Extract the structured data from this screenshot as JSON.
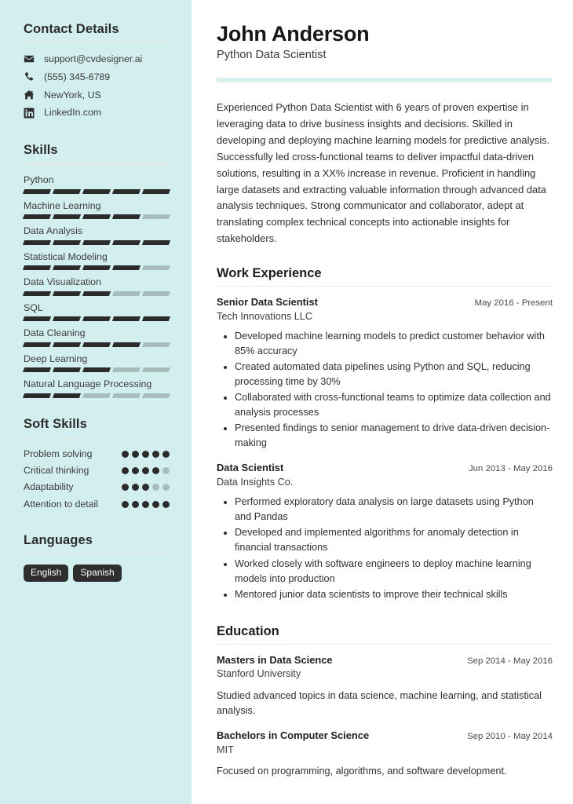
{
  "theme": {
    "sidebar_bg": "#d3eeee",
    "accent_bar": "#d8f0f0",
    "rule": "#f2e6da",
    "filled": "#2b2b2b",
    "empty": "#a9bcbc",
    "tag_bg": "#2e2e2e"
  },
  "sidebar": {
    "contact": {
      "heading": "Contact Details",
      "items": [
        {
          "icon": "envelope-icon",
          "text": "support@cvdesigner.ai"
        },
        {
          "icon": "phone-icon",
          "text": "(555) 345-6789"
        },
        {
          "icon": "home-icon",
          "text": "NewYork, US"
        },
        {
          "icon": "linkedin-icon",
          "text": "LinkedIn.com"
        }
      ]
    },
    "skills": {
      "heading": "Skills",
      "max_level": 5,
      "items": [
        {
          "name": "Python",
          "level": 5
        },
        {
          "name": "Machine Learning",
          "level": 4
        },
        {
          "name": "Data Analysis",
          "level": 5
        },
        {
          "name": "Statistical Modeling",
          "level": 4
        },
        {
          "name": "Data Visualization",
          "level": 3
        },
        {
          "name": "SQL",
          "level": 5
        },
        {
          "name": "Data Cleaning",
          "level": 4
        },
        {
          "name": "Deep Learning",
          "level": 3
        },
        {
          "name": "Natural Language Processing",
          "level": 2
        }
      ]
    },
    "soft_skills": {
      "heading": "Soft Skills",
      "max_level": 5,
      "items": [
        {
          "name": "Problem solving",
          "level": 5
        },
        {
          "name": "Critical thinking",
          "level": 4
        },
        {
          "name": "Adaptability",
          "level": 3
        },
        {
          "name": "Attention to detail",
          "level": 5
        }
      ]
    },
    "languages": {
      "heading": "Languages",
      "items": [
        "English",
        "Spanish"
      ]
    }
  },
  "main": {
    "full_name": "John Anderson",
    "job_title": "Python Data Scientist",
    "summary": "Experienced Python Data Scientist with 6 years of proven expertise in leveraging data to drive business insights and decisions. Skilled in developing and deploying machine learning models for predictive analysis. Successfully led cross-functional teams to deliver impactful data-driven solutions, resulting in a XX% increase in revenue. Proficient in handling large datasets and extracting valuable information through advanced data analysis techniques. Strong communicator and collaborator, adept at translating complex technical concepts into actionable insights for stakeholders.",
    "work": {
      "heading": "Work Experience",
      "entries": [
        {
          "title": "Senior Data Scientist",
          "date": "May 2016 - Present",
          "org": "Tech Innovations LLC",
          "bullets": [
            "Developed machine learning models to predict customer behavior with 85% accuracy",
            "Created automated data pipelines using Python and SQL, reducing processing time by 30%",
            "Collaborated with cross-functional teams to optimize data collection and analysis processes",
            "Presented findings to senior management to drive data-driven decision-making"
          ]
        },
        {
          "title": "Data Scientist",
          "date": "Jun 2013 - May 2016",
          "org": "Data Insights Co.",
          "bullets": [
            "Performed exploratory data analysis on large datasets using Python and Pandas",
            "Developed and implemented algorithms for anomaly detection in financial transactions",
            "Worked closely with software engineers to deploy machine learning models into production",
            "Mentored junior data scientists to improve their technical skills"
          ]
        }
      ]
    },
    "education": {
      "heading": "Education",
      "entries": [
        {
          "title": "Masters in Data Science",
          "date": "Sep 2014 - May 2016",
          "org": "Stanford University",
          "desc": "Studied advanced topics in data science, machine learning, and statistical analysis."
        },
        {
          "title": "Bachelors in Computer Science",
          "date": "Sep 2010 - May 2014",
          "org": "MIT",
          "desc": "Focused on programming, algorithms, and software development."
        }
      ]
    }
  }
}
